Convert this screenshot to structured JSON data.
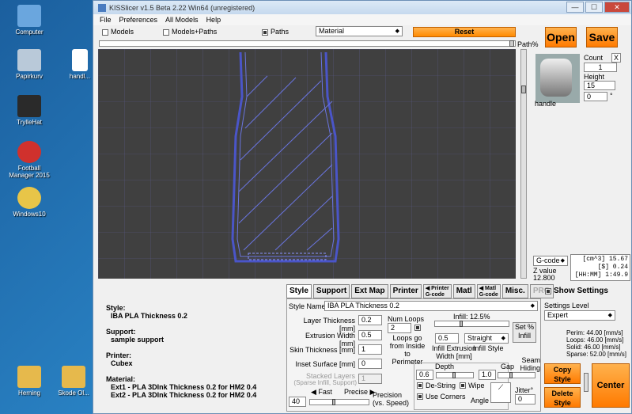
{
  "desktop": {
    "icons": [
      {
        "label": "Computer",
        "color": "#6aa6de"
      },
      {
        "label": "Papirkurv",
        "color": "#b9c9d9"
      },
      {
        "label": "TrylleHat",
        "color": "#2a2a2a"
      },
      {
        "label": "Football Manager 2015",
        "color": "#d0312d"
      },
      {
        "label": "Windows10",
        "color": "#e8c548"
      },
      {
        "label": "Herning",
        "color": "#e6b94c"
      },
      {
        "label": "Skode Ol...",
        "color": "#e6b94c"
      },
      {
        "label": "handl...",
        "color": "#ffffff"
      }
    ]
  },
  "window": {
    "title": "KISSlicer v1.5 Beta 2.22 Win64 (unregistered)",
    "controls": [
      "—",
      "☐",
      "✕"
    ]
  },
  "menu": [
    "File",
    "Preferences",
    "All Models",
    "Help"
  ],
  "toolbar": {
    "models_label": "Models",
    "models_paths_label": "Models+Paths",
    "paths_label": "Paths",
    "view_select": "Material",
    "reset_label": "Reset",
    "open_label": "Open",
    "save_label": "Save",
    "path_pct_label": "Path%"
  },
  "model": {
    "name": "handle",
    "count_label": "Count",
    "count_value": "1",
    "height_label": "Height",
    "height_value": "15",
    "rotation_value": "0",
    "degree_symbol": "°",
    "close_x": "X"
  },
  "gcode": {
    "select": "G-code",
    "zvalue_label": "Z value",
    "zvalue": "12.800",
    "lines": [
      "[cm^3] 15.67",
      "[$] 0.24",
      "[HH:MM] 1:49.9"
    ]
  },
  "info": {
    "style_heading": "Style:",
    "style_value": "IBA PLA Thickness 0.2",
    "support_heading": "Support:",
    "support_value": "sample support",
    "printer_heading": "Printer:",
    "printer_value": "Cubex",
    "material_heading": "Material:",
    "material_ext1": "Ext1 - PLA 3DInk Thickness 0.2 for HM2 0.4",
    "material_ext2": "Ext2 - PLA 3DInk Thickness 0.2 for HM2 0.4"
  },
  "tabs": {
    "style": "Style",
    "support": "Support",
    "extmap": "Ext Map",
    "printer": "Printer",
    "printer_gcode_top": "Printer",
    "printer_gcode_bottom": "G-code",
    "matl": "Matl",
    "matl_gcode_top": "Matl",
    "matl_gcode_bottom": "G-code",
    "misc": "Misc.",
    "pro": "PRO"
  },
  "style_panel": {
    "style_name_label": "Style Name",
    "style_name_value": "IBA PLA Thickness 0.2",
    "layer_thickness_label": "Layer Thickness [mm]",
    "layer_thickness_value": "0.2",
    "extrusion_width_label": "Extrusion Width [mm]",
    "extrusion_width_value": "0.5",
    "skin_thickness_label": "Skin Thickness [mm]",
    "skin_thickness_value": "1",
    "inset_surface_label": "Inset  Surface [mm]",
    "inset_surface_value": "0",
    "stacked_layers_label": "Stacked Layers",
    "stacked_layers_sub": "(Sparse Infill, Support)",
    "stacked_layers_value": "1",
    "num_loops_label": "Num Loops",
    "num_loops_value": "2",
    "infill_label": "Infill: 12.5%",
    "infill_pct": 12.5,
    "set_infill_label": "Set %\nInfill",
    "loops_go_label": "Loops go\nfrom Inside\nto Perimeter",
    "infill_ext_width_value": "0.5",
    "infill_ext_width_label": "Infill Extrusion\nWidth [mm]",
    "infill_style_value": "Straight",
    "infill_style_label": "Infill Style",
    "seam_hiding_label": "Seam Hiding",
    "depth_label": "Depth",
    "depth_value": "0.6",
    "gap_label": "Gap",
    "gap_value": "1.0",
    "destring_label": "De-String",
    "wipe_label": "Wipe",
    "use_corners_label": "Use Corners",
    "angle_label": "Angle",
    "jitter_label": "Jitter°",
    "jitter_value": "0",
    "fast_label": "Fast",
    "precise_label": "Precise",
    "precision_value": "40",
    "precision_label": "Precision\n(vs. Speed)"
  },
  "settings": {
    "show_label": "Show Settings",
    "level_label": "Settings Level",
    "level_value": "Expert",
    "perim": "Perim: 44.00 [mm/s]",
    "loops": "Loops: 46.00 [mm/s]",
    "solid": "Solid: 46.00 [mm/s]",
    "sparse": "Sparse: 52.00 [mm/s]",
    "copy_style": "Copy Style",
    "delete_style": "Delete Style",
    "center": "Center"
  }
}
